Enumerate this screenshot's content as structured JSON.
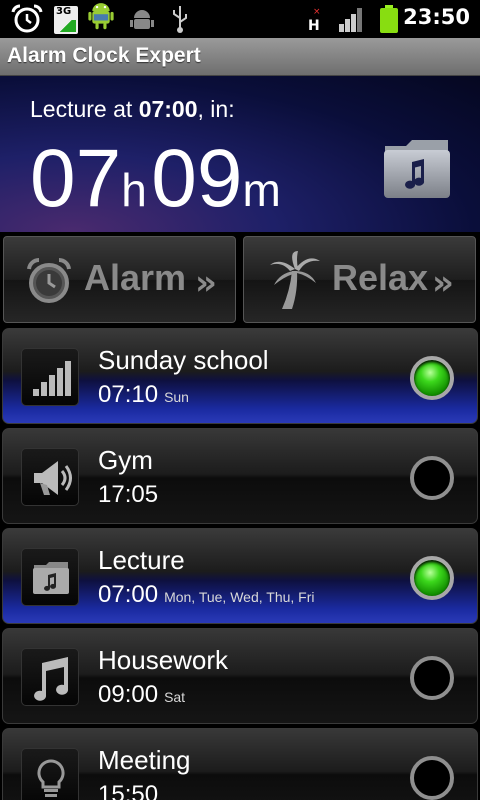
{
  "status_bar": {
    "time": "23:50",
    "network_label": "3G",
    "icons": [
      "alarm-clock-icon",
      "3g-icon",
      "android-icon",
      "debug-icon",
      "usb-icon",
      "network-h-icon",
      "signal-icon",
      "battery-icon"
    ]
  },
  "app": {
    "title": "Alarm Clock Expert"
  },
  "header": {
    "prefix": "Lecture at ",
    "time": "07:00",
    "suffix": ", in:",
    "hours": "07",
    "hours_unit": "h",
    "minutes": "09",
    "minutes_unit": "m"
  },
  "buttons": {
    "alarm": {
      "label": "Alarm",
      "arrows": "»"
    },
    "relax": {
      "label": "Relax",
      "arrows": "»"
    }
  },
  "alarms": [
    {
      "name": "Sunday school",
      "time": "07:10",
      "days": "Sun",
      "enabled": true,
      "icon": "signal-bars-icon"
    },
    {
      "name": "Gym",
      "time": "17:05",
      "days": "",
      "enabled": false,
      "icon": "megaphone-icon"
    },
    {
      "name": "Lecture",
      "time": "07:00",
      "days": "Mon, Tue, Wed, Thu, Fri",
      "enabled": true,
      "icon": "music-folder-icon"
    },
    {
      "name": "Housework",
      "time": "09:00",
      "days": "Sat",
      "enabled": false,
      "icon": "music-note-icon"
    },
    {
      "name": "Meeting",
      "time": "15:50",
      "days": "",
      "enabled": false,
      "icon": "light-bulb-icon"
    }
  ],
  "colors": {
    "accent_blue": "#1a2aa0",
    "toggle_on": "#3cd81c"
  }
}
